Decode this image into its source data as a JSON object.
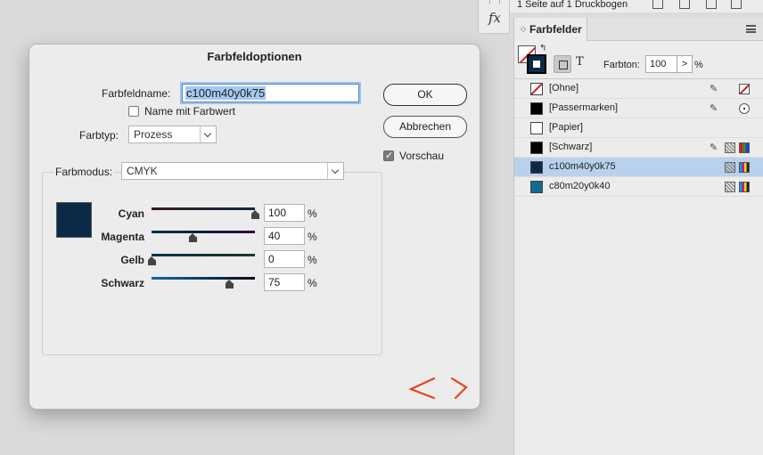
{
  "topbar": {
    "pages_info": "1 Seite auf 1 Druckbogen"
  },
  "fx_label": "fx",
  "dialog": {
    "title": "Farbfeldoptionen",
    "name_label": "Farbfeldname:",
    "name_value": "c100m40y0k75",
    "name_with_value_label": "Name mit Farbwert",
    "name_with_value_checked": false,
    "type_label": "Farbtyp:",
    "type_value": "Prozess",
    "mode_label": "Farbmodus:",
    "mode_value": "CMYK",
    "ok_label": "OK",
    "cancel_label": "Abbrechen",
    "preview_label": "Vorschau",
    "preview_checked": true,
    "swatch_color": "#0a2a47",
    "channels": [
      {
        "label": "Cyan",
        "value": "100",
        "unit": "%",
        "fraction": 1.0,
        "gradient": [
          "#3b1a1a",
          "#0a2a47"
        ]
      },
      {
        "label": "Magenta",
        "value": "40",
        "unit": "%",
        "fraction": 0.4,
        "gradient": [
          "#003240",
          "#2a0a40"
        ]
      },
      {
        "label": "Gelb",
        "value": "0",
        "unit": "%",
        "fraction": 0.0,
        "gradient": [
          "#003448",
          "#1a3a20"
        ]
      },
      {
        "label": "Schwarz",
        "value": "75",
        "unit": "%",
        "fraction": 0.75,
        "gradient": [
          "#0a6aa8",
          "#0a0a14"
        ]
      }
    ]
  },
  "panel": {
    "title": "Farbfelder",
    "tint_label": "Farbton:",
    "tint_value": "100",
    "tint_unit": "%",
    "swatches": [
      {
        "name": "[Ohne]",
        "color": "none",
        "selected": false,
        "icons": [
          "pencil-icon",
          "none-icon"
        ]
      },
      {
        "name": "[Passermarken]",
        "color": "#000000",
        "selected": false,
        "icons": [
          "pencil-icon",
          "registration-icon"
        ]
      },
      {
        "name": "[Papier]",
        "color": "#ffffff",
        "selected": false,
        "icons": []
      },
      {
        "name": "[Schwarz]",
        "color": "#000000",
        "selected": false,
        "icons": [
          "pencil-icon",
          "process-icon",
          "color-mode-icon"
        ]
      },
      {
        "name": "c100m40y0k75",
        "color": "#0a2a47",
        "selected": true,
        "icons": [
          "process-icon",
          "cmyk-icon"
        ]
      },
      {
        "name": "c80m20y0k40",
        "color": "#126a94",
        "selected": false,
        "icons": [
          "process-icon",
          "cmyk-icon"
        ]
      }
    ]
  }
}
